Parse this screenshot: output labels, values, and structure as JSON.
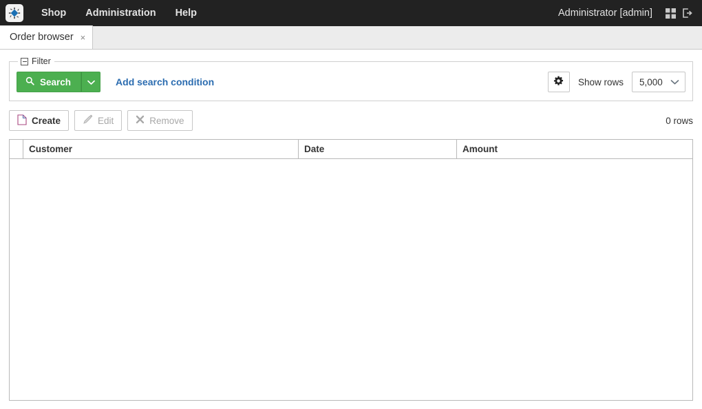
{
  "navbar": {
    "logo_icon": "app-logo-icon",
    "links": [
      {
        "label": "Shop"
      },
      {
        "label": "Administration"
      },
      {
        "label": "Help"
      }
    ],
    "user_label": "Administrator [admin]",
    "grid_icon": "grid-apps-icon",
    "logout_icon": "logout-icon"
  },
  "tabs": [
    {
      "label": "Order browser",
      "close_label": "×"
    }
  ],
  "filter": {
    "legend": "Filter",
    "collapse_icon": "minus-box-icon",
    "search_label": "Search",
    "search_icon": "magnifier-icon",
    "search_caret_icon": "chevron-down-icon",
    "add_condition_label": "Add search condition",
    "settings_icon": "gear-icon",
    "show_rows_label": "Show rows",
    "rows_value": "5,000",
    "rows_caret_icon": "chevron-down-icon"
  },
  "toolbar": {
    "create_label": "Create",
    "create_icon": "new-document-icon",
    "edit_label": "Edit",
    "edit_icon": "pencil-icon",
    "remove_label": "Remove",
    "remove_icon": "cross-icon",
    "rows_count": "0 rows"
  },
  "table": {
    "columns": [
      {
        "label": ""
      },
      {
        "label": "Customer"
      },
      {
        "label": "Date"
      },
      {
        "label": "Amount"
      }
    ],
    "rows": []
  },
  "colors": {
    "navbar_bg": "#222222",
    "accent_green": "#4caf50",
    "link_blue": "#2b6cb0",
    "tabbar_bg": "#ececec",
    "border_gray": "#b8b8b8"
  }
}
